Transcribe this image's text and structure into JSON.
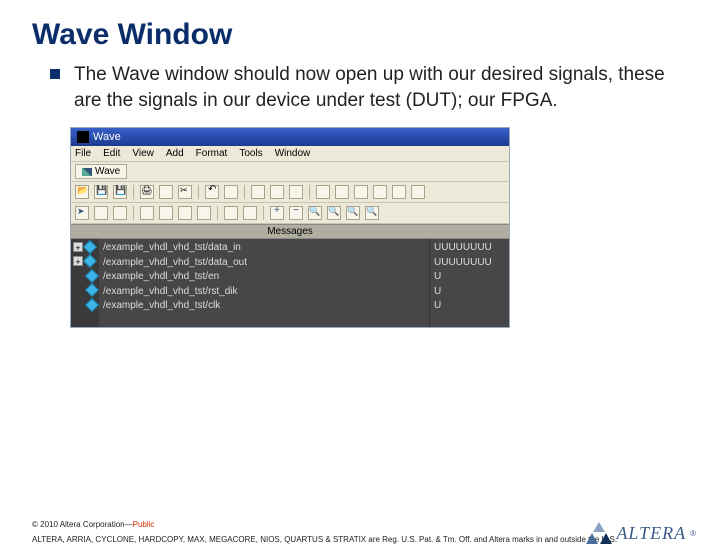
{
  "title": "Wave Window",
  "body": "The Wave window should now open up with our desired signals, these are the signals in our device under test (DUT); our FPGA.",
  "wave": {
    "window_title": "Wave",
    "menu": [
      "File",
      "Edit",
      "View",
      "Add",
      "Format",
      "Tools",
      "Window"
    ],
    "tab": "Wave",
    "messages_header": "Messages",
    "signals": [
      {
        "expand": true,
        "name": "/example_vhdl_vhd_tst/data_in",
        "value": "UUUUUUUU"
      },
      {
        "expand": true,
        "name": "/example_vhdl_vhd_tst/data_out",
        "value": "UUUUUUUU"
      },
      {
        "expand": false,
        "name": "/example_vhdl_vhd_tst/en",
        "value": "U"
      },
      {
        "expand": false,
        "name": "/example_vhdl_vhd_tst/rst_dik",
        "value": "U"
      },
      {
        "expand": false,
        "name": "/example_vhdl_vhd_tst/clk",
        "value": "U"
      }
    ]
  },
  "footer": {
    "copyright": "© 2010 Altera Corporation—",
    "public": "Public",
    "legal": "ALTERA, ARRIA, CYCLONE, HARDCOPY, MAX, MEGACORE, NIOS, QUARTUS & STRATIX are Reg. U.S. Pat. & Tm. Off. and Altera marks in and outside the U.S.",
    "logo": "ALTERA",
    "reg": "®"
  }
}
